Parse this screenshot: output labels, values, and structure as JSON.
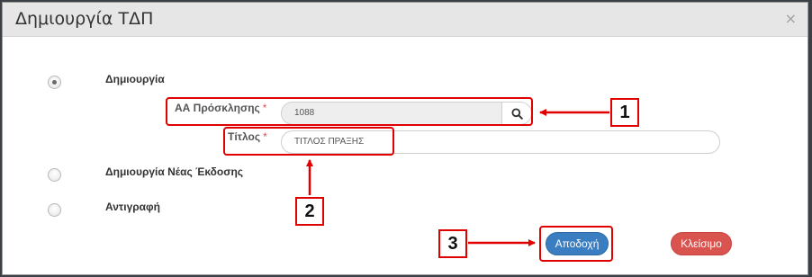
{
  "dialog": {
    "title": "Δημιουργία ΤΔΠ",
    "close_symbol": "×"
  },
  "options": [
    {
      "label": "Δημιουργία",
      "selected": true
    },
    {
      "label": "Δημιουργία Νέας Έκδοσης",
      "selected": false
    },
    {
      "label": "Αντιγραφή",
      "selected": false
    }
  ],
  "fields": {
    "invitation": {
      "label": "ΑΑ Πρόσκλησης",
      "required_mark": "*",
      "value": "1088"
    },
    "title": {
      "label": "Τίτλος",
      "required_mark": "*",
      "value": "ΤΙΤΛΟΣ ΠΡΑΞΗΣ"
    }
  },
  "buttons": {
    "accept": "Αποδοχή",
    "close": "Κλείσιμο"
  },
  "callouts": [
    "1",
    "2",
    "3"
  ],
  "colors": {
    "highlight": "#e00000",
    "accept": "#3a7dc0",
    "close": "#d9534f"
  },
  "icons": {
    "search": "search-icon",
    "close": "close-icon"
  }
}
